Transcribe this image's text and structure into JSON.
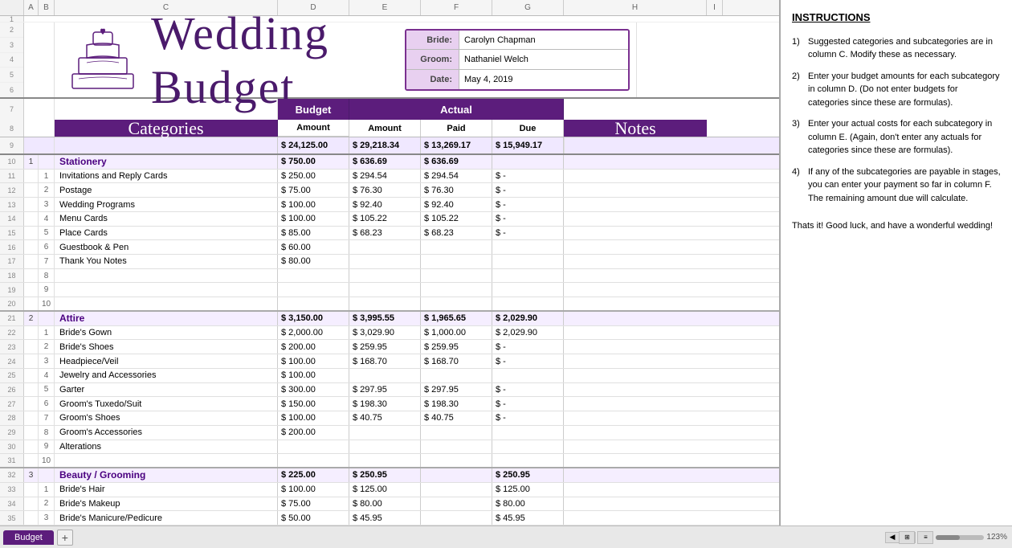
{
  "title": "Wedding Budget",
  "bride": "Carolyn Chapman",
  "groom": "Nathaniel Welch",
  "date": "May 4, 2019",
  "labels": {
    "bride": "Bride:",
    "groom": "Groom:",
    "date": "Date:",
    "budget": "Budget",
    "actual": "Actual",
    "amount": "Amount",
    "paid": "Paid",
    "due": "Due",
    "categories": "Categories",
    "notes": "Notes",
    "instructions_title": "INSTRUCTIONS"
  },
  "totals": {
    "budget_amount": "$ 24,125.00",
    "actual_amount": "$ 29,218.34",
    "actual_paid": "$ 13,269.17",
    "actual_due": "$ 15,949.17"
  },
  "categories": [
    {
      "num": "1",
      "name": "Stationery",
      "budget": "$ 750.00",
      "actual": "$ 636.69",
      "paid": "$ 636.69",
      "due": "",
      "subcategories": [
        {
          "num": "1",
          "name": "Invitations and Reply Cards",
          "budget": "$ 250.00",
          "actual": "$ 294.54",
          "paid": "$ 294.54",
          "due": "$ -"
        },
        {
          "num": "2",
          "name": "Postage",
          "budget": "$ 75.00",
          "actual": "$ 76.30",
          "paid": "$ 76.30",
          "due": "$ -"
        },
        {
          "num": "3",
          "name": "Wedding Programs",
          "budget": "$ 100.00",
          "actual": "$ 92.40",
          "paid": "$ 92.40",
          "due": "$ -"
        },
        {
          "num": "4",
          "name": "Menu Cards",
          "budget": "$ 100.00",
          "actual": "$ 105.22",
          "paid": "$ 105.22",
          "due": "$ -"
        },
        {
          "num": "5",
          "name": "Place Cards",
          "budget": "$ 85.00",
          "actual": "$ 68.23",
          "paid": "$ 68.23",
          "due": "$ -"
        },
        {
          "num": "6",
          "name": "Guestbook & Pen",
          "budget": "$ 60.00",
          "actual": "",
          "paid": "",
          "due": ""
        },
        {
          "num": "7",
          "name": "Thank You Notes",
          "budget": "$ 80.00",
          "actual": "",
          "paid": "",
          "due": ""
        },
        {
          "num": "8",
          "name": "",
          "budget": "",
          "actual": "",
          "paid": "",
          "due": ""
        },
        {
          "num": "9",
          "name": "",
          "budget": "",
          "actual": "",
          "paid": "",
          "due": ""
        },
        {
          "num": "10",
          "name": "",
          "budget": "",
          "actual": "",
          "paid": "",
          "due": ""
        }
      ]
    },
    {
      "num": "2",
      "name": "Attire",
      "budget": "$ 3,150.00",
      "actual": "$ 3,995.55",
      "paid": "$ 1,965.65",
      "due": "$ 2,029.90",
      "subcategories": [
        {
          "num": "1",
          "name": "Bride's Gown",
          "budget": "$ 2,000.00",
          "actual": "$ 3,029.90",
          "paid": "$ 1,000.00",
          "due": "$ 2,029.90"
        },
        {
          "num": "2",
          "name": "Bride's Shoes",
          "budget": "$ 200.00",
          "actual": "$ 259.95",
          "paid": "$ 259.95",
          "due": "$ -"
        },
        {
          "num": "3",
          "name": "Headpiece/Veil",
          "budget": "$ 100.00",
          "actual": "$ 168.70",
          "paid": "$ 168.70",
          "due": "$ -"
        },
        {
          "num": "4",
          "name": "Jewelry and Accessories",
          "budget": "$ 100.00",
          "actual": "",
          "paid": "",
          "due": ""
        },
        {
          "num": "5",
          "name": "Garter",
          "budget": "$ 300.00",
          "actual": "$ 297.95",
          "paid": "$ 297.95",
          "due": "$ -"
        },
        {
          "num": "6",
          "name": "Groom's Tuxedo/Suit",
          "budget": "$ 150.00",
          "actual": "$ 198.30",
          "paid": "$ 198.30",
          "due": "$ -"
        },
        {
          "num": "7",
          "name": "Groom's Shoes",
          "budget": "$ 100.00",
          "actual": "$ 40.75",
          "paid": "$ 40.75",
          "due": "$ -"
        },
        {
          "num": "8",
          "name": "Groom's Accessories",
          "budget": "$ 200.00",
          "actual": "",
          "paid": "",
          "due": ""
        },
        {
          "num": "9",
          "name": "Alterations",
          "budget": "",
          "actual": "",
          "paid": "",
          "due": ""
        },
        {
          "num": "10",
          "name": "",
          "budget": "",
          "actual": "",
          "paid": "",
          "due": ""
        }
      ]
    },
    {
      "num": "3",
      "name": "Beauty / Grooming",
      "budget": "$ 225.00",
      "actual": "$ 250.95",
      "paid": "",
      "due": "$ 250.95",
      "subcategories": [
        {
          "num": "1",
          "name": "Bride's Hair",
          "budget": "$ 100.00",
          "actual": "$ 125.00",
          "paid": "",
          "due": "$ 125.00"
        },
        {
          "num": "2",
          "name": "Bride's Makeup",
          "budget": "$ 75.00",
          "actual": "$ 80.00",
          "paid": "",
          "due": "$ 80.00"
        },
        {
          "num": "3",
          "name": "Bride's Manicure/Pedicure",
          "budget": "$ 50.00",
          "actual": "$ 45.95",
          "paid": "",
          "due": "$ 45.95"
        }
      ]
    }
  ],
  "instructions": [
    "Suggested categories and subcategories are in column C.  Modify these as necessary.",
    "Enter your budget amounts for each subcategory in column D.  (Do not enter budgets for categories since these are formulas).",
    "Enter your actual costs for each subcategory in column E.  (Again, don't enter any actuals for categories since these are formulas).",
    "If any of the subcategories are payable in stages, you can enter your payment so far in column F.  The remaining amount due will calculate."
  ],
  "sign_off": "Thats it!  Good luck, and have a wonderful wedding!",
  "sheet_tab": "Budget",
  "col_headers": [
    "A",
    "B",
    "C",
    "D",
    "E",
    "F",
    "G",
    "H",
    "I"
  ]
}
